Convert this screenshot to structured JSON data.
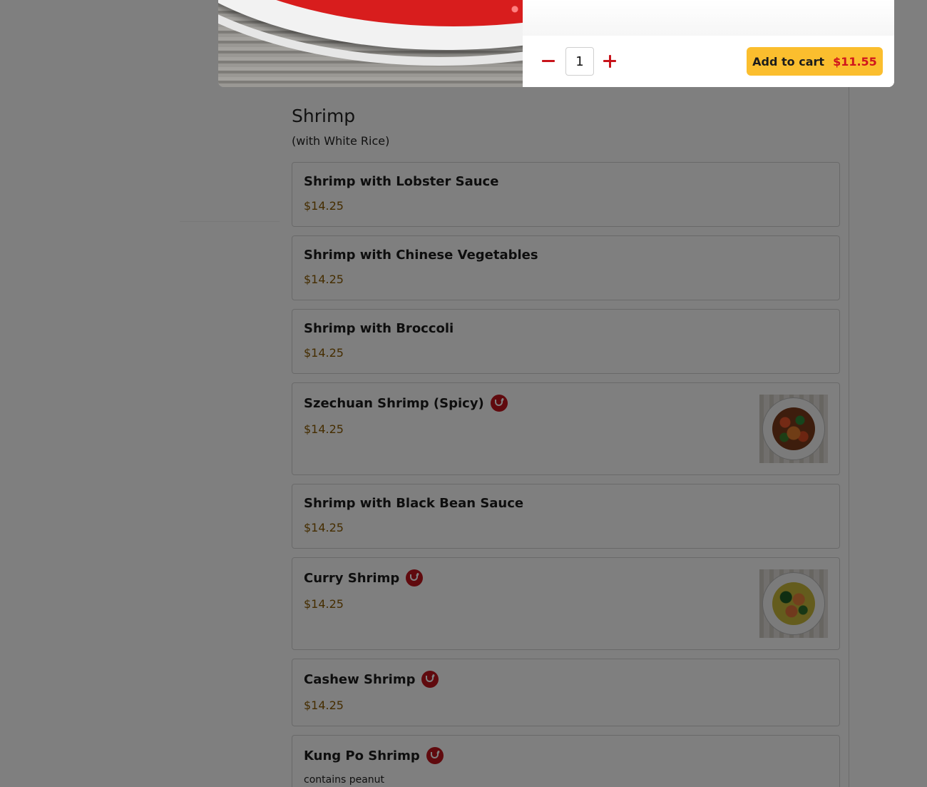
{
  "modal": {
    "quantity": "1",
    "add_to_cart_label": "Add to cart",
    "add_to_cart_price": "$11.55"
  },
  "section": {
    "title": "Shrimp",
    "subtitle": "(with White Rice)"
  },
  "items": [
    {
      "name": "Shrimp with Lobster Sauce",
      "price": "$14.25",
      "spicy": false,
      "image": false
    },
    {
      "name": "Shrimp with Chinese Vegetables",
      "price": "$14.25",
      "spicy": false,
      "image": false
    },
    {
      "name": "Shrimp with Broccoli",
      "price": "$14.25",
      "spicy": false,
      "image": false
    },
    {
      "name": "Szechuan Shrimp (Spicy)",
      "price": "$14.25",
      "spicy": true,
      "image": true,
      "image_icon": "szechuan-shrimp-photo"
    },
    {
      "name": "Shrimp with Black Bean Sauce",
      "price": "$14.25",
      "spicy": false,
      "image": false
    },
    {
      "name": "Curry Shrimp",
      "price": "$14.25",
      "spicy": true,
      "image": true,
      "image_icon": "curry-shrimp-photo"
    },
    {
      "name": "Cashew Shrimp",
      "price": "$14.25",
      "spicy": true,
      "image": false
    },
    {
      "name": "Kung Po Shrimp",
      "note": "contains peanut",
      "spicy": true,
      "image": false
    }
  ],
  "icons": {
    "spicy": "chili-pepper-icon",
    "decrease": "minus-icon",
    "increase": "plus-icon"
  },
  "colors": {
    "accent": "#c8141b",
    "button": "#fbbe2e",
    "price": "#8a5a00",
    "overlay": "rgba(0,0,0,0.5)"
  }
}
